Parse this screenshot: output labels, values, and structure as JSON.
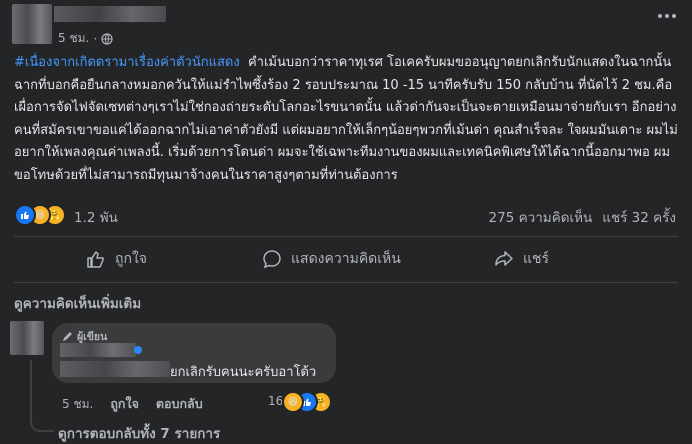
{
  "post": {
    "time": "5 ชม.",
    "hashtag": "#เนื่องจากเกิดดรามาเรื่องค่าตัวนักแสดง",
    "body": "คำเม้นบอกว่าราคาทุเรศ โอเคครับผมขออนุญาตยกเลิกรับนักแสดงในฉากนั้น ฉากที่บอกคือยืนกลางหมอกควันให้แม่รำไพซึ้งร้อง 2 รอบประมาณ 10 -15 นาทีครับรับ 150 กลับบ้าน ที่นัดไว้ 2 ชม.คือเผื่อการจัดไฟจัดเซทต่างๆเราไม่ใช่กองถ่ายระดับโลกอะไรขนาดนั้น แล้วด่ากันจะเป็นจะตายเหมือนมาจ่ายกับเรา อีกอย่างคนที่สมัครเขาขอแค่ได้ออกฉากไม่เอาค่าตัวยังมี แต่ผมอยากให้เล็กๆน้อยๆพวกที่เม้นด่า คุณสำเร็จละ ใจผมมันเดาะ ผมไม่อยากให้เพลงคุณค่าเพลงนี้. เริ่มด้วยการโดนด่า ผมจะใช้เฉพาะทีมงานของผมและเทคนิคพิเศษให้ได้ฉากนี้ออกมาพอ ผมขอโทษด้วยที่ไม่สามารถมีทุนมาจ้างคนในราคาสูงๆตามที่ท่านต้องการ"
  },
  "stats": {
    "reactions_count": "1.2 พัน",
    "comments": "275 ความคิดเห็น",
    "shares": "แชร์ 32 ครั้ง"
  },
  "actions": {
    "like": "ถูกใจ",
    "comment": "แสดงความคิดเห็น",
    "share": "แชร์"
  },
  "comments_section": {
    "more_comments": "ดูความคิดเห็นเพิ่มเติม",
    "comment": {
      "badge": "ผู้เขียน",
      "text": "ยกเลิกรับคนนะครับอาโด้ว",
      "time": "5 ชม.",
      "like": "ถูกใจ",
      "reply": "ตอบกลับ",
      "reaction_count": "16"
    },
    "view_replies": "ดูการตอบกลับทั้ง 7 รายการ"
  },
  "colors": {
    "background": "#242526",
    "hashtag": "#4599ff",
    "text": "#e4e6eb",
    "muted": "#b0b3b8"
  }
}
